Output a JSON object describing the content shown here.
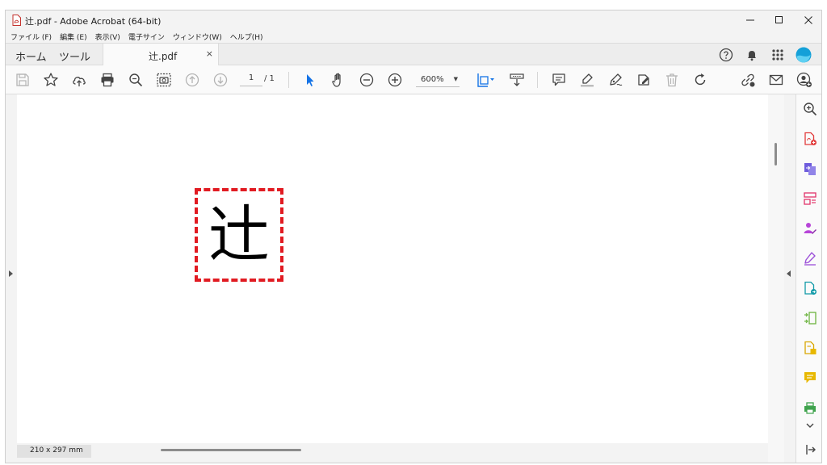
{
  "window": {
    "title": "辻.pdf - Adobe Acrobat (64-bit)",
    "minimize_label": "—",
    "maximize_label": "☐",
    "close_label": "✕"
  },
  "menu": {
    "items": [
      "ファイル (F)",
      "編集 (E)",
      "表示(V)",
      "電子サイン",
      "ウィンドウ(W)",
      "ヘルプ(H)"
    ]
  },
  "tabs": {
    "home": "ホーム",
    "tools": "ツール",
    "document": "辻.pdf",
    "close": "×"
  },
  "toolbar": {
    "current_page": "1",
    "page_total": "/ 1",
    "zoom": "600%",
    "zoom_caret": "▼"
  },
  "document": {
    "glyph": "辻"
  },
  "status": {
    "page_size": "210 x 297 mm"
  },
  "colors": {
    "highlight_border": "#e11b22",
    "accent_blue": "#1473e6"
  },
  "icons": {
    "toolbar": [
      "save-icon",
      "star-icon",
      "cloud-upload-icon",
      "print-icon",
      "find-icon",
      "snapshot-icon",
      "page-up-icon",
      "page-down-icon",
      "select-cursor-icon",
      "hand-icon",
      "zoom-out-icon",
      "zoom-in-icon",
      "fit-page-icon",
      "scroll-mode-icon",
      "comment-icon",
      "highlight-icon",
      "draw-icon",
      "stamp-icon",
      "delete-icon",
      "rotate-icon",
      "share-link-icon",
      "email-icon",
      "add-user-icon"
    ],
    "right_panel": [
      "zoom-panel-icon",
      "create-pdf-icon",
      "export-pdf-icon",
      "organize-pages-icon",
      "request-signature-icon",
      "fill-sign-icon",
      "send-pdf-icon",
      "compress-pdf-icon",
      "edit-pdf-icon",
      "comment-panel-icon",
      "print-production-icon",
      "expand-more-icon",
      "collapse-panel-icon"
    ]
  }
}
